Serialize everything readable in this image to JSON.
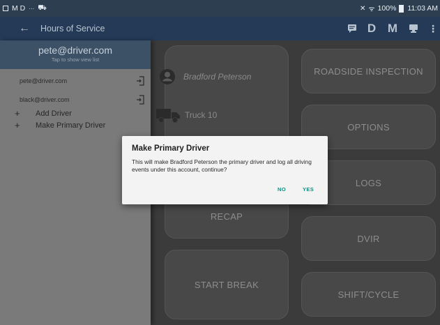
{
  "statusbar": {
    "left_text": "M D",
    "battery": "100%",
    "time": "11:03 AM"
  },
  "appbar": {
    "back_icon": "arrow-left-icon",
    "title": "Hours of Service",
    "actions": [
      {
        "name": "chat-icon",
        "glyph": "💬"
      },
      {
        "name": "d-button",
        "label": "D"
      },
      {
        "name": "m-button",
        "label": "M"
      },
      {
        "name": "monitor-icon",
        "glyph": "🖥"
      },
      {
        "name": "more-vert-icon",
        "glyph": "⋮"
      }
    ]
  },
  "drawer": {
    "header_email": "pete@driver.com",
    "header_hint": "Tap to show view list",
    "accounts": [
      {
        "email": "pete@driver.com"
      },
      {
        "email": "black@driver.com"
      }
    ],
    "menu": [
      {
        "label": "Add Driver"
      },
      {
        "label": "Make Primary Driver"
      }
    ]
  },
  "main": {
    "driver_name": "Bradford Peterson",
    "truck": "Truck 10",
    "tiles": {
      "recap": "RECAP",
      "start_break": "START BREAK",
      "roadside": "ROADSIDE INSPECTION",
      "options": "OPTIONS",
      "logs": "LOGS",
      "dvir": "DVIR",
      "shift_cycle": "SHIFT/CYCLE"
    }
  },
  "dialog": {
    "title": "Make Primary Driver",
    "message": "This will make Bradford Peterson the primary driver and log all driving events under this account, continue?",
    "no_label": "NO",
    "yes_label": "YES"
  },
  "colors": {
    "statusbar_bg": "#2c3e50",
    "appbar_bg": "#243a57",
    "drawer_header_bg": "#3d5166",
    "dialog_button": "#0f8f7f"
  }
}
